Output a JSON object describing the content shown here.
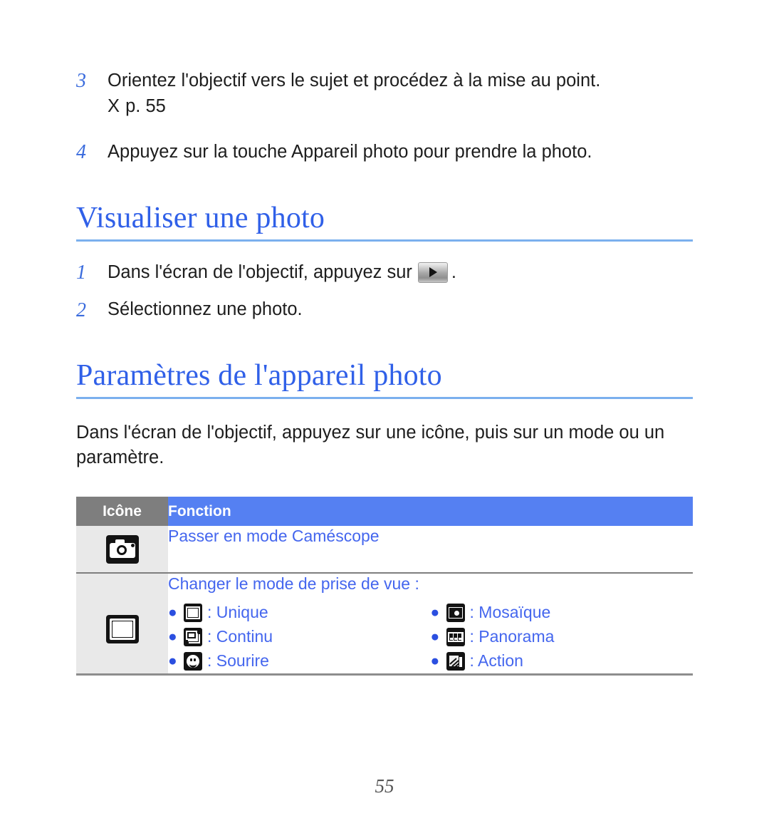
{
  "steps_top": [
    {
      "num": "3",
      "text": "Orientez l'objectif vers le sujet et procédez à la mise au point.",
      "ref_glyph": "X",
      "ref_text": "p. 55"
    },
    {
      "num": "4",
      "text": "Appuyez sur la touche Appareil photo pour prendre la photo."
    }
  ],
  "section_view": {
    "heading": "Visualiser une photo",
    "step1_num": "1",
    "step1_before": "Dans l'écran de l'objectif, appuyez sur",
    "step1_after": ".",
    "step1_icon": "play-button-icon",
    "step2_num": "2",
    "step2_text": "Sélectionnez une photo."
  },
  "section_settings": {
    "heading": "Paramètres de l'appareil photo",
    "intro": "Dans l'écran de l'objectif, appuyez sur une icône, puis sur un mode ou un paramètre."
  },
  "table": {
    "headers": {
      "icon": "Icône",
      "function": "Fonction"
    },
    "rows": [
      {
        "icon_name": "camera-icon",
        "function": "Passer en mode Caméscope"
      },
      {
        "icon_name": "shooting-mode-frame-icon",
        "function": "Changer le mode de prise de vue :",
        "modes_left": [
          {
            "icon_name": "single-shot-icon",
            "separator": ":",
            "label": "Unique"
          },
          {
            "icon_name": "continuous-shot-icon",
            "separator": ":",
            "label": "Continu"
          },
          {
            "icon_name": "smile-shot-icon",
            "separator": ":",
            "label": "Sourire"
          }
        ],
        "modes_right": [
          {
            "icon_name": "mosaic-shot-icon",
            "separator": ":",
            "label": "Mosaïque"
          },
          {
            "icon_name": "panorama-shot-icon",
            "separator": ":",
            "label": "Panorama"
          },
          {
            "icon_name": "action-shot-icon",
            "separator": ":",
            "label": "Action"
          }
        ]
      }
    ]
  },
  "folio": "55",
  "colors": {
    "heading_blue": "#3060e8",
    "link_blue": "#4466ee",
    "header_blue": "#5580f2",
    "header_gray": "#7e7e7e",
    "icon_cell_gray": "#e9e9e9",
    "rule_blue": "#7bb0ee"
  }
}
